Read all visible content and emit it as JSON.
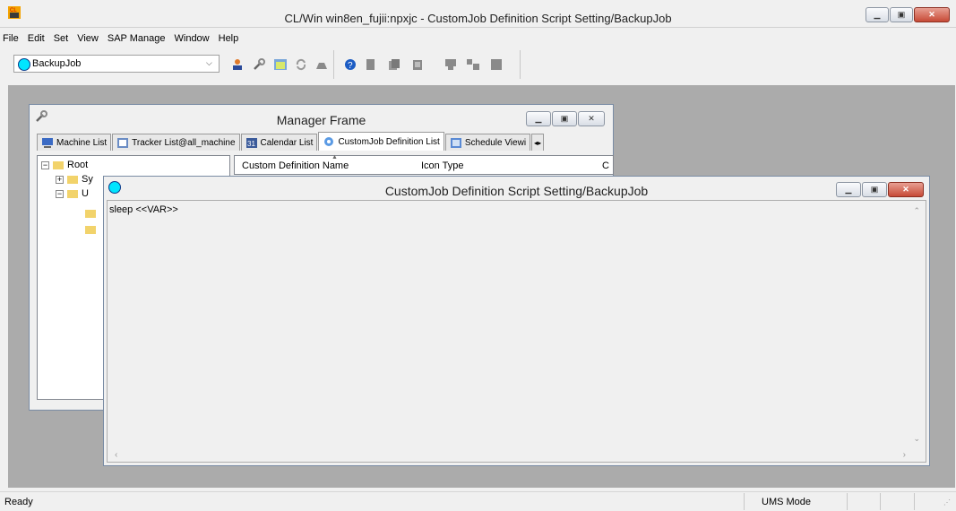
{
  "app": {
    "title": "CL/Win win8en_fujii:npxjc - CustomJob Definition Script Setting/BackupJob",
    "window_controls": [
      "minimize",
      "restore",
      "close"
    ]
  },
  "menu": [
    "File",
    "Edit",
    "Set",
    "View",
    "SAP Manage",
    "Window",
    "Help"
  ],
  "toolbar": {
    "selected_job": "BackupJob",
    "icons": [
      "user-icon",
      "wrench-icon",
      "calendar-icon",
      "refresh-icon",
      "monitor-icon",
      "help-icon",
      "document-icon",
      "document-stack-icon",
      "document-edit-icon",
      "job-run-icon",
      "job-transfer-icon",
      "grid-icon"
    ]
  },
  "manager": {
    "title": "Manager Frame",
    "tabs": [
      {
        "label": "Machine List",
        "icon": "computer-icon"
      },
      {
        "label": "Tracker List@all_machine",
        "icon": "table-icon"
      },
      {
        "label": "Calendar List",
        "icon": "calendar-icon"
      },
      {
        "label": "CustomJob Definition List",
        "icon": "gear-icon",
        "active": true
      },
      {
        "label": "Schedule Viewi",
        "icon": "grid-icon"
      }
    ],
    "tree": {
      "root": "Root",
      "children": [
        "Sy",
        "U"
      ]
    },
    "columns": [
      "Custom Definition Name",
      "Icon Type",
      "C"
    ]
  },
  "script_window": {
    "title": "CustomJob Definition Script Setting/BackupJob",
    "content": "sleep <<VAR>>"
  },
  "status": {
    "text": "Ready",
    "mode": "UMS Mode"
  },
  "colors": {
    "mdi_background": "#ababab",
    "cyan_icon": "#00e5ff",
    "window_border": "#7a8ca5"
  }
}
